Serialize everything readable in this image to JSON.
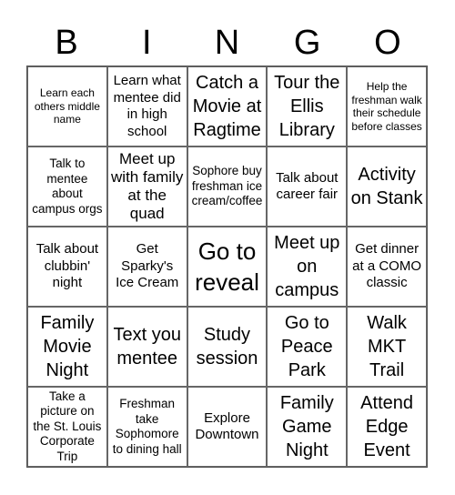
{
  "header": {
    "letters": [
      "B",
      "I",
      "N",
      "G",
      "O"
    ]
  },
  "board": {
    "cells": [
      [
        "Learn each others middle name",
        "Learn what mentee did in high school",
        "Catch a Movie at Ragtime",
        "Tour the Ellis Library",
        "Help the freshman walk their schedule before classes"
      ],
      [
        "Talk to mentee about campus orgs",
        "Meet up with family at the quad",
        "Sophore buy freshman ice cream/coffee",
        "Talk about career fair",
        "Activity on Stank"
      ],
      [
        "Talk about clubbin' night",
        "Get Sparky's Ice Cream",
        "Go to reveal",
        "Meet up on campus",
        "Get dinner at a COMO classic"
      ],
      [
        "Family Movie Night",
        "Text you mentee",
        "Study session",
        "Go to Peace Park",
        "Walk MKT Trail"
      ],
      [
        "Take a picture on the St. Louis Corporate Trip",
        "Freshman take Sophomore to dining hall",
        "Explore Downtown",
        "Family Game Night",
        "Attend Edge Event"
      ]
    ]
  }
}
